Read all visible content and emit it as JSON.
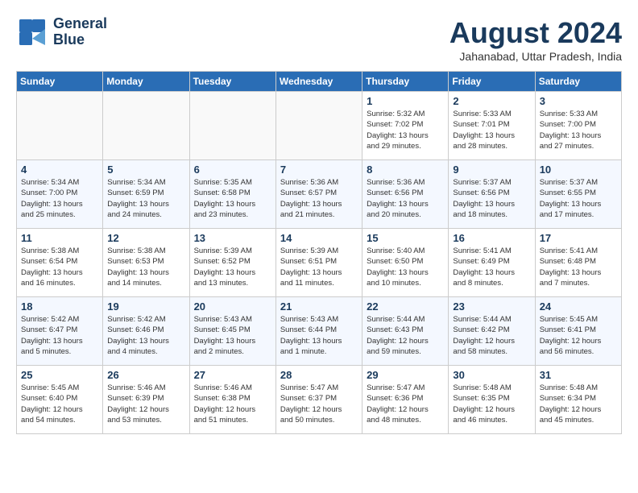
{
  "header": {
    "logo_line1": "General",
    "logo_line2": "Blue",
    "month": "August 2024",
    "location": "Jahanabad, Uttar Pradesh, India"
  },
  "weekdays": [
    "Sunday",
    "Monday",
    "Tuesday",
    "Wednesday",
    "Thursday",
    "Friday",
    "Saturday"
  ],
  "weeks": [
    [
      {
        "day": "",
        "detail": ""
      },
      {
        "day": "",
        "detail": ""
      },
      {
        "day": "",
        "detail": ""
      },
      {
        "day": "",
        "detail": ""
      },
      {
        "day": "1",
        "detail": "Sunrise: 5:32 AM\nSunset: 7:02 PM\nDaylight: 13 hours\nand 29 minutes."
      },
      {
        "day": "2",
        "detail": "Sunrise: 5:33 AM\nSunset: 7:01 PM\nDaylight: 13 hours\nand 28 minutes."
      },
      {
        "day": "3",
        "detail": "Sunrise: 5:33 AM\nSunset: 7:00 PM\nDaylight: 13 hours\nand 27 minutes."
      }
    ],
    [
      {
        "day": "4",
        "detail": "Sunrise: 5:34 AM\nSunset: 7:00 PM\nDaylight: 13 hours\nand 25 minutes."
      },
      {
        "day": "5",
        "detail": "Sunrise: 5:34 AM\nSunset: 6:59 PM\nDaylight: 13 hours\nand 24 minutes."
      },
      {
        "day": "6",
        "detail": "Sunrise: 5:35 AM\nSunset: 6:58 PM\nDaylight: 13 hours\nand 23 minutes."
      },
      {
        "day": "7",
        "detail": "Sunrise: 5:36 AM\nSunset: 6:57 PM\nDaylight: 13 hours\nand 21 minutes."
      },
      {
        "day": "8",
        "detail": "Sunrise: 5:36 AM\nSunset: 6:56 PM\nDaylight: 13 hours\nand 20 minutes."
      },
      {
        "day": "9",
        "detail": "Sunrise: 5:37 AM\nSunset: 6:56 PM\nDaylight: 13 hours\nand 18 minutes."
      },
      {
        "day": "10",
        "detail": "Sunrise: 5:37 AM\nSunset: 6:55 PM\nDaylight: 13 hours\nand 17 minutes."
      }
    ],
    [
      {
        "day": "11",
        "detail": "Sunrise: 5:38 AM\nSunset: 6:54 PM\nDaylight: 13 hours\nand 16 minutes."
      },
      {
        "day": "12",
        "detail": "Sunrise: 5:38 AM\nSunset: 6:53 PM\nDaylight: 13 hours\nand 14 minutes."
      },
      {
        "day": "13",
        "detail": "Sunrise: 5:39 AM\nSunset: 6:52 PM\nDaylight: 13 hours\nand 13 minutes."
      },
      {
        "day": "14",
        "detail": "Sunrise: 5:39 AM\nSunset: 6:51 PM\nDaylight: 13 hours\nand 11 minutes."
      },
      {
        "day": "15",
        "detail": "Sunrise: 5:40 AM\nSunset: 6:50 PM\nDaylight: 13 hours\nand 10 minutes."
      },
      {
        "day": "16",
        "detail": "Sunrise: 5:41 AM\nSunset: 6:49 PM\nDaylight: 13 hours\nand 8 minutes."
      },
      {
        "day": "17",
        "detail": "Sunrise: 5:41 AM\nSunset: 6:48 PM\nDaylight: 13 hours\nand 7 minutes."
      }
    ],
    [
      {
        "day": "18",
        "detail": "Sunrise: 5:42 AM\nSunset: 6:47 PM\nDaylight: 13 hours\nand 5 minutes."
      },
      {
        "day": "19",
        "detail": "Sunrise: 5:42 AM\nSunset: 6:46 PM\nDaylight: 13 hours\nand 4 minutes."
      },
      {
        "day": "20",
        "detail": "Sunrise: 5:43 AM\nSunset: 6:45 PM\nDaylight: 13 hours\nand 2 minutes."
      },
      {
        "day": "21",
        "detail": "Sunrise: 5:43 AM\nSunset: 6:44 PM\nDaylight: 13 hours\nand 1 minute."
      },
      {
        "day": "22",
        "detail": "Sunrise: 5:44 AM\nSunset: 6:43 PM\nDaylight: 12 hours\nand 59 minutes."
      },
      {
        "day": "23",
        "detail": "Sunrise: 5:44 AM\nSunset: 6:42 PM\nDaylight: 12 hours\nand 58 minutes."
      },
      {
        "day": "24",
        "detail": "Sunrise: 5:45 AM\nSunset: 6:41 PM\nDaylight: 12 hours\nand 56 minutes."
      }
    ],
    [
      {
        "day": "25",
        "detail": "Sunrise: 5:45 AM\nSunset: 6:40 PM\nDaylight: 12 hours\nand 54 minutes."
      },
      {
        "day": "26",
        "detail": "Sunrise: 5:46 AM\nSunset: 6:39 PM\nDaylight: 12 hours\nand 53 minutes."
      },
      {
        "day": "27",
        "detail": "Sunrise: 5:46 AM\nSunset: 6:38 PM\nDaylight: 12 hours\nand 51 minutes."
      },
      {
        "day": "28",
        "detail": "Sunrise: 5:47 AM\nSunset: 6:37 PM\nDaylight: 12 hours\nand 50 minutes."
      },
      {
        "day": "29",
        "detail": "Sunrise: 5:47 AM\nSunset: 6:36 PM\nDaylight: 12 hours\nand 48 minutes."
      },
      {
        "day": "30",
        "detail": "Sunrise: 5:48 AM\nSunset: 6:35 PM\nDaylight: 12 hours\nand 46 minutes."
      },
      {
        "day": "31",
        "detail": "Sunrise: 5:48 AM\nSunset: 6:34 PM\nDaylight: 12 hours\nand 45 minutes."
      }
    ]
  ]
}
